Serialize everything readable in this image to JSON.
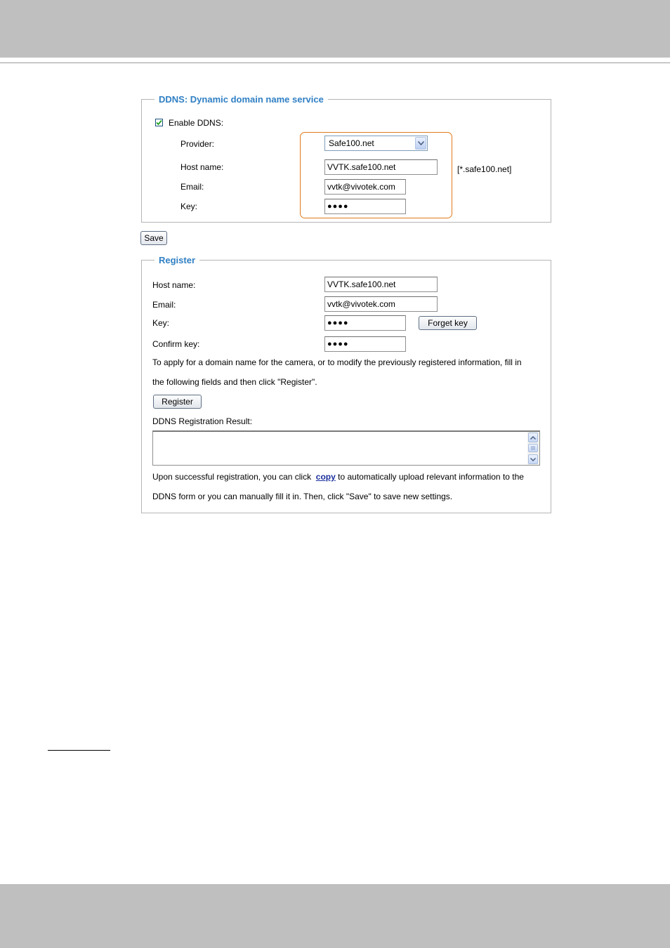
{
  "ddns": {
    "legend": "DDNS: Dynamic domain name service",
    "enable_label": "Enable DDNS:",
    "enable_checked": true,
    "provider_label": "Provider:",
    "provider_value": "Safe100.net",
    "hostname_label": "Host name:",
    "hostname_value": "VVTK.safe100.net",
    "hostname_hint": "[*.safe100.net]",
    "email_label": "Email:",
    "email_value": "vvtk@vivotek.com",
    "key_label": "Key:",
    "key_value": "●●●●",
    "highlight_color": "#e07b1d"
  },
  "save_label": "Save",
  "register": {
    "legend": "Register",
    "hostname_label": "Host name:",
    "hostname_value": "VVTK.safe100.net",
    "email_label": "Email:",
    "email_value": "vvtk@vivotek.com",
    "key_label": "Key:",
    "key_value": "●●●●",
    "forget_key_label": "Forget key",
    "confirm_key_label": "Confirm key:",
    "confirm_key_value": "●●●●",
    "instruction_line1": "To apply for a domain name for the camera, or to modify the previously registered information, fill in",
    "instruction_line2": "the following fields and then click \"Register\".",
    "register_button_label": "Register",
    "result_label": "DDNS Registration Result:",
    "result_value": "",
    "upon_prefix": "Upon successful registration, you can click",
    "copy_link": "copy",
    "upon_suffix": "to automatically upload relevant information to the",
    "upon_line2": "DDNS form or you can manually fill it in. Then, click \"Save\" to save new settings."
  },
  "colors": {
    "legend": "#2f7fc4",
    "header_footer_bar": "#bfbfbf",
    "link": "#1a2f9e"
  }
}
